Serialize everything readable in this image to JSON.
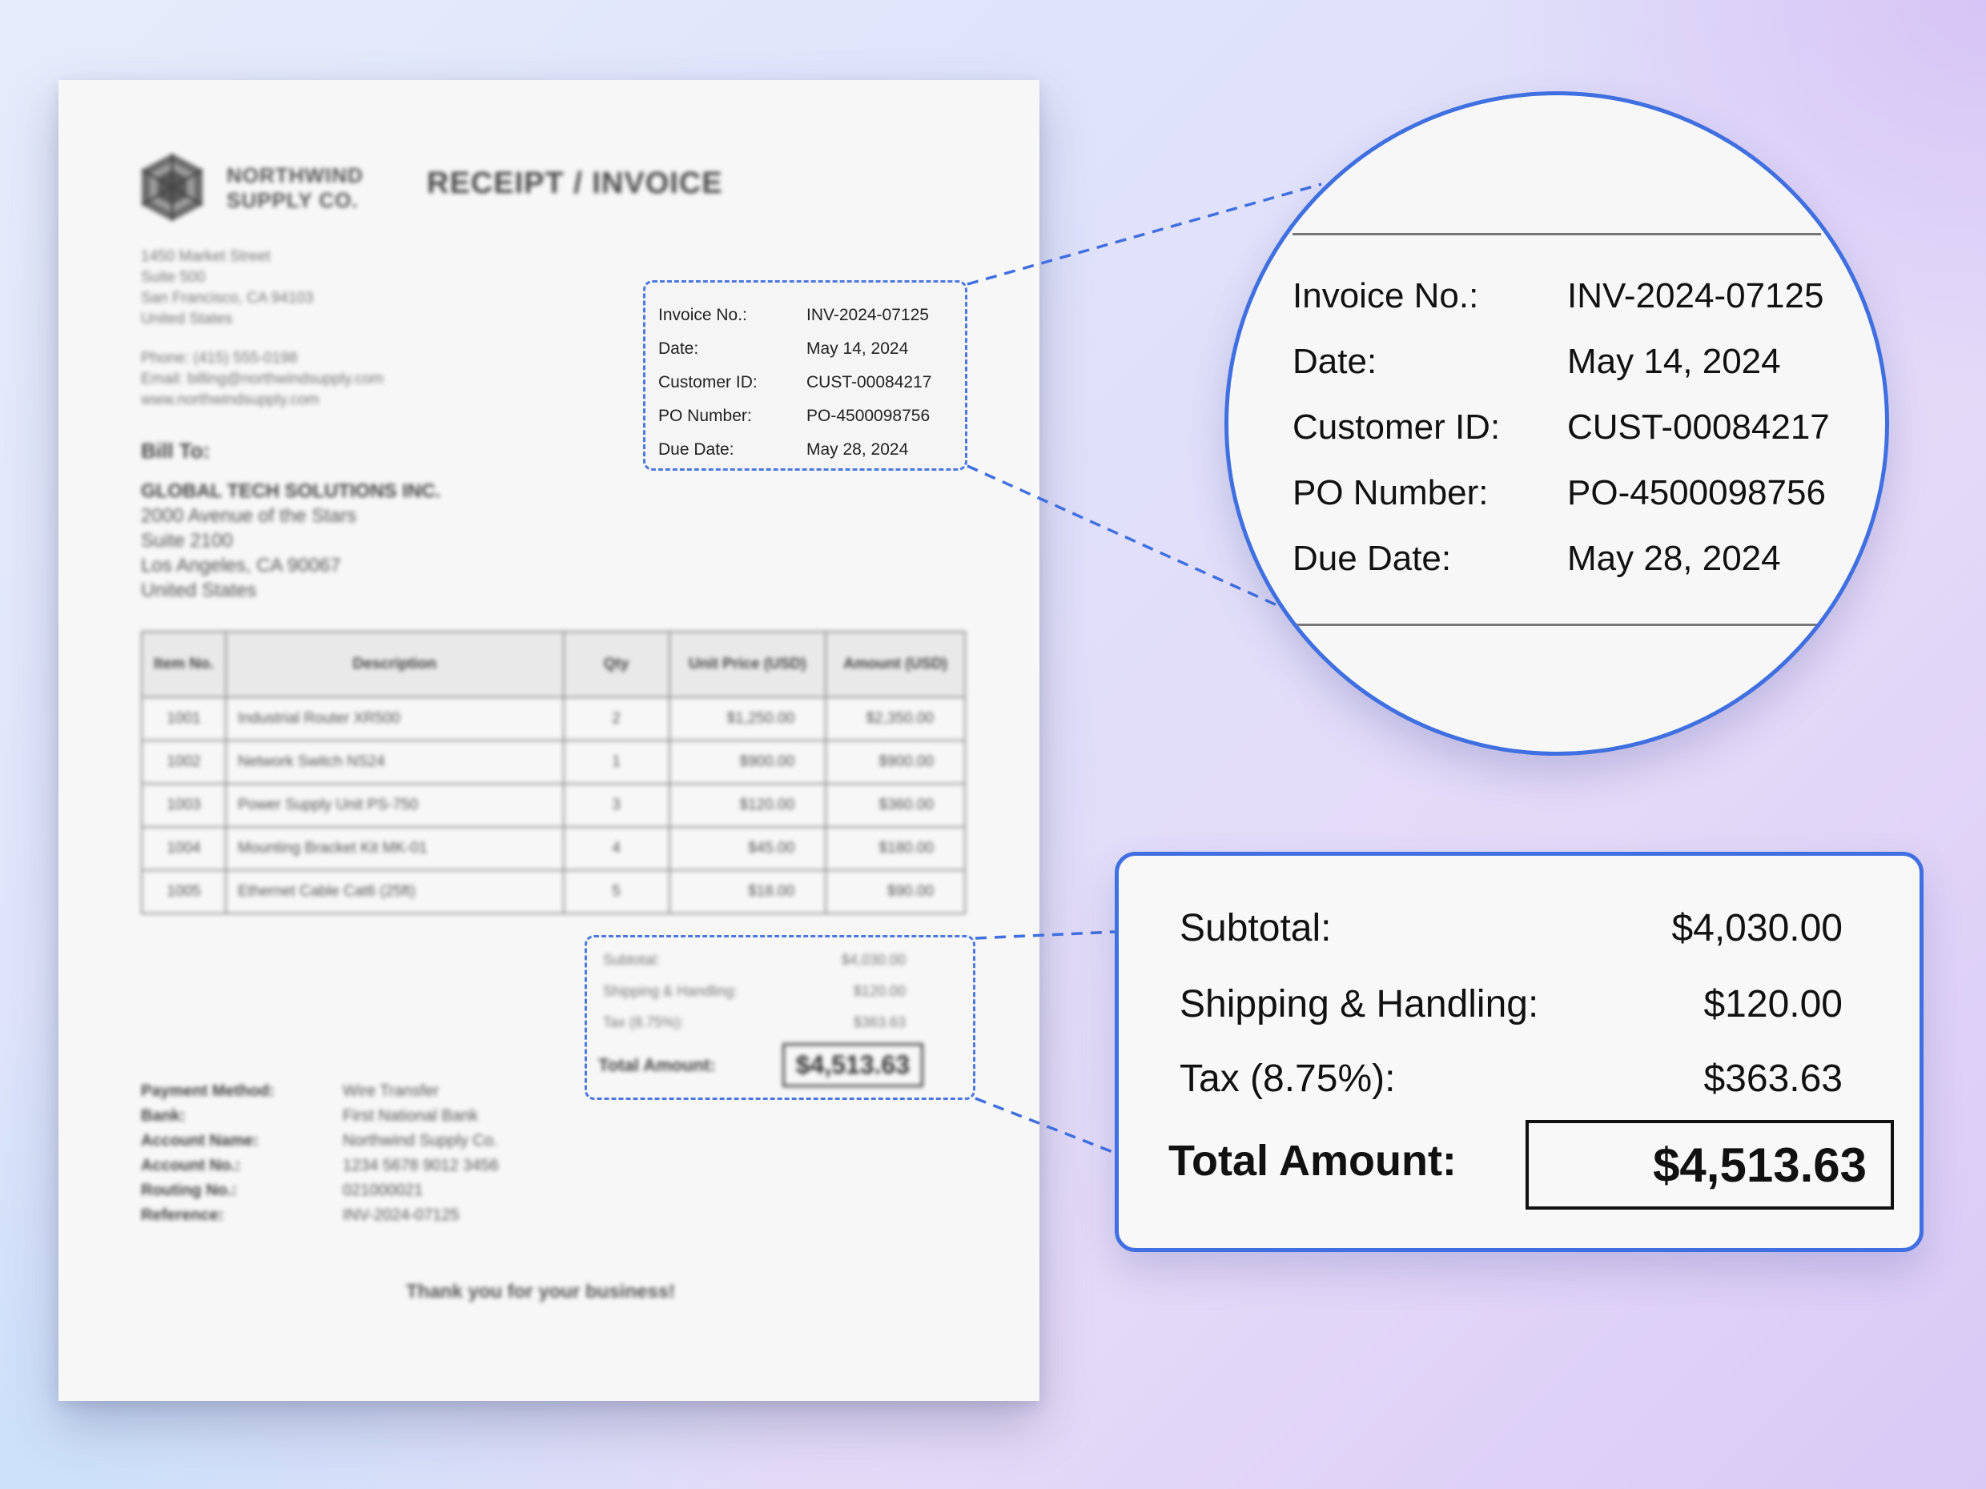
{
  "company": {
    "name_line1": "NORTHWIND",
    "name_line2": "SUPPLY CO.",
    "address": [
      "1450 Market Street",
      "Suite 500",
      "San Francisco, CA 94103",
      "United States"
    ],
    "phone": "Phone: (415) 555-0198",
    "email": "Email: billing@northwindsupply.com",
    "website": "www.northwindsupply.com"
  },
  "document": {
    "title": "RECEIPT / INVOICE"
  },
  "invoice_meta": [
    {
      "label": "Invoice No.:",
      "value": "INV-2024-07125"
    },
    {
      "label": "Date:",
      "value": "May 14, 2024"
    },
    {
      "label": "Customer ID:",
      "value": "CUST-00084217"
    },
    {
      "label": "PO Number:",
      "value": "PO-4500098756"
    },
    {
      "label": "Due Date:",
      "value": "May 28, 2024"
    }
  ],
  "bill_to": {
    "label": "Bill To:",
    "company": "GLOBAL TECH SOLUTIONS INC.",
    "lines": [
      "2000 Avenue of the Stars",
      "Suite 2100",
      "Los Angeles, CA 90067",
      "United States"
    ]
  },
  "items": {
    "headers": [
      "Item No.",
      "Description",
      "Qty",
      "Unit Price (USD)",
      "Amount (USD)"
    ],
    "rows": [
      [
        "1001",
        "Industrial Router XR500",
        "2",
        "$1,250.00",
        "$2,350.00"
      ],
      [
        "1002",
        "Network Switch NS24",
        "1",
        "$900.00",
        "$900.00"
      ],
      [
        "1003",
        "Power Supply Unit PS-750",
        "3",
        "$120.00",
        "$360.00"
      ],
      [
        "1004",
        "Mounting Bracket Kit MK-01",
        "4",
        "$45.00",
        "$180.00"
      ],
      [
        "1005",
        "Ethernet Cable Cat6 (25ft)",
        "5",
        "$18.00",
        "$90.00"
      ]
    ]
  },
  "totals": {
    "subtotal_label": "Subtotal:",
    "subtotal": "$4,030.00",
    "shipping_label": "Shipping & Handling:",
    "shipping": "$120.00",
    "tax_label": "Tax (8.75%):",
    "tax": "$363.63",
    "total_label": "Total Amount:",
    "total": "$4,513.63"
  },
  "payment": [
    {
      "label": "Payment Method:",
      "value": "Wire Transfer"
    },
    {
      "label": "Bank:",
      "value": "First National Bank"
    },
    {
      "label": "Account Name:",
      "value": "Northwind Supply Co."
    },
    {
      "label": "Account No.:",
      "value": "1234 5678 9012 3456"
    },
    {
      "label": "Routing No.:",
      "value": "021000021"
    },
    {
      "label": "Reference:",
      "value": "INV-2024-07125"
    }
  ],
  "footer": {
    "thanks": "Thank you for your business!"
  },
  "colors": {
    "accent": "#3f6fe0",
    "dashed": "#4d79de"
  }
}
